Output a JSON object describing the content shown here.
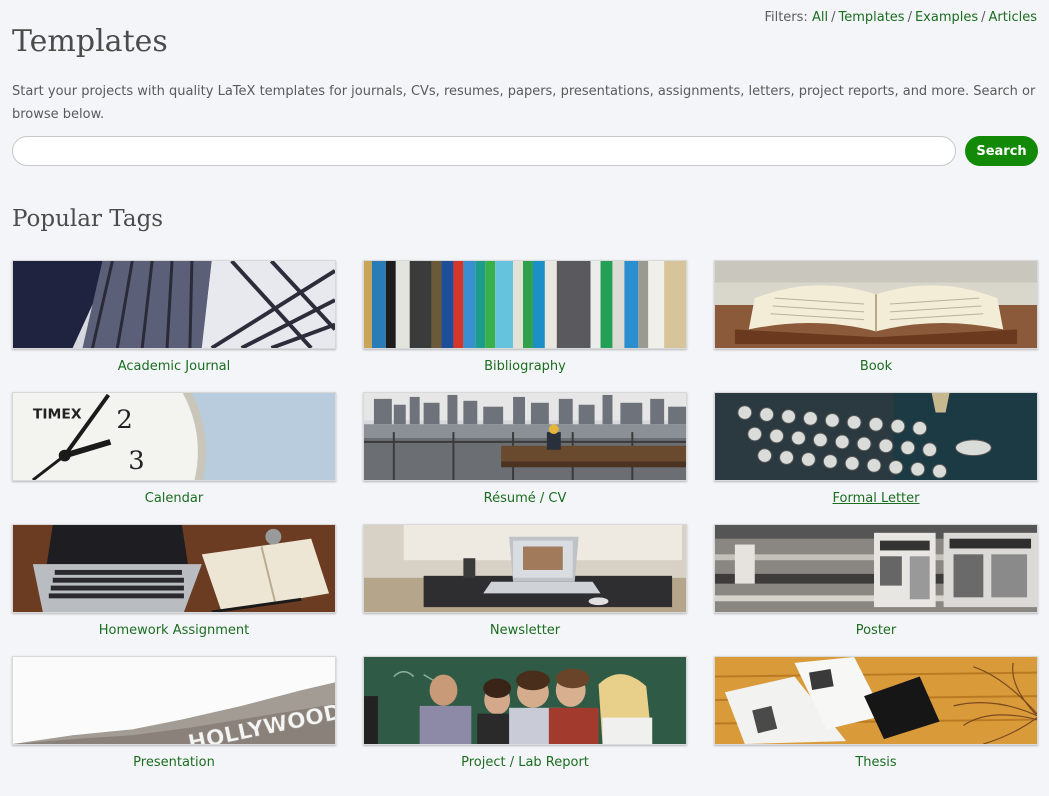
{
  "filters": {
    "prefix": "Filters:",
    "items": [
      "All",
      "Templates",
      "Examples",
      "Articles"
    ],
    "separator": "/"
  },
  "header": {
    "title": "Templates",
    "intro": "Start your projects with quality LaTeX templates for journals, CVs, resumes, papers, presentations, assignments, letters, project reports, and more. Search or browse below."
  },
  "search": {
    "value": "",
    "placeholder": "",
    "button_label": "Search"
  },
  "popular": {
    "title": "Popular Tags",
    "tags": [
      {
        "label": "Academic Journal",
        "image": "library-shelves-photo"
      },
      {
        "label": "Bibliography",
        "image": "book-spines-photo"
      },
      {
        "label": "Book",
        "image": "open-book-photo"
      },
      {
        "label": "Calendar",
        "image": "clock-face-photo"
      },
      {
        "label": "Résumé / CV",
        "image": "city-waterfront-bench-photo"
      },
      {
        "label": "Formal Letter",
        "image": "typewriter-photo"
      },
      {
        "label": "Homework Assignment",
        "image": "laptop-notebook-desk-photo"
      },
      {
        "label": "Newsletter",
        "image": "laptop-office-desk-photo"
      },
      {
        "label": "Poster",
        "image": "motion-blur-posters-photo"
      },
      {
        "label": "Presentation",
        "image": "hollywood-sign-photo"
      },
      {
        "label": "Project / Lab Report",
        "image": "students-classroom-photo"
      },
      {
        "label": "Thesis",
        "image": "magazine-on-table-photo"
      }
    ]
  },
  "colors": {
    "link": "#1b6d20",
    "button": "#138a07",
    "background": "#f4f5f8"
  }
}
